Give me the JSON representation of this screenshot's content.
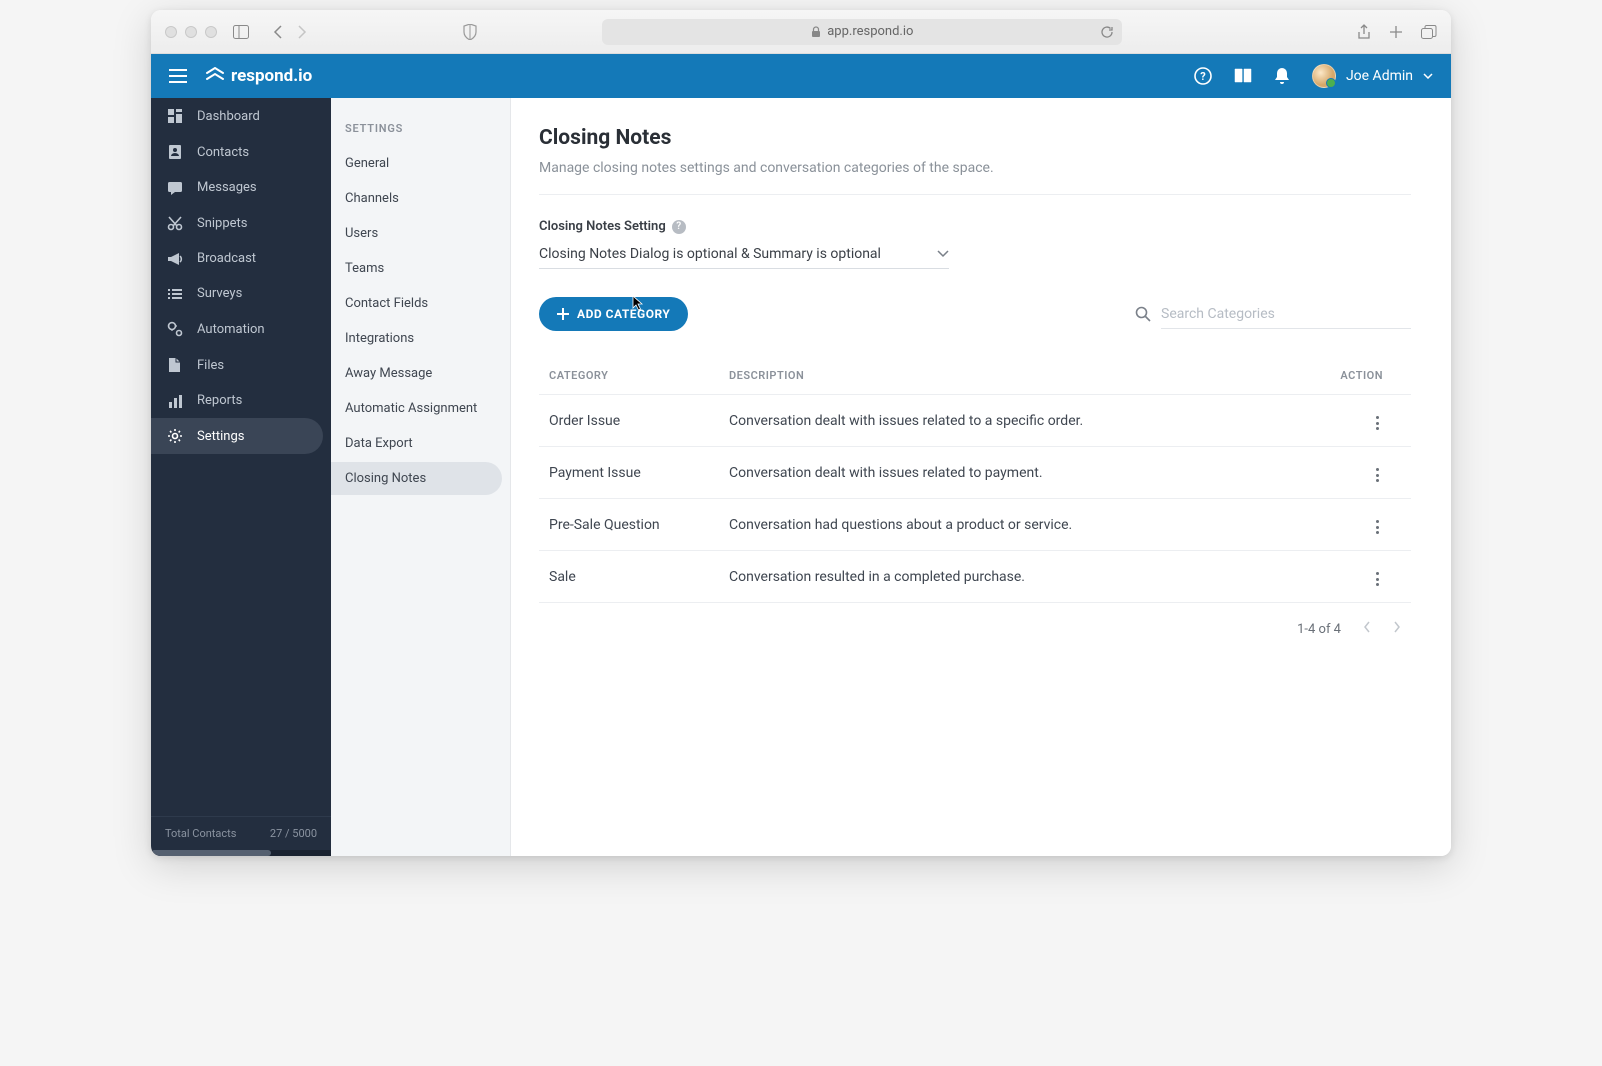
{
  "browser": {
    "url": "app.respond.io"
  },
  "header": {
    "brand": "respond.io",
    "user_name": "Joe Admin"
  },
  "sidebar_primary": {
    "items": [
      {
        "label": "Dashboard",
        "icon": "dashboard"
      },
      {
        "label": "Contacts",
        "icon": "contacts"
      },
      {
        "label": "Messages",
        "icon": "messages"
      },
      {
        "label": "Snippets",
        "icon": "snippets"
      },
      {
        "label": "Broadcast",
        "icon": "broadcast"
      },
      {
        "label": "Surveys",
        "icon": "surveys"
      },
      {
        "label": "Automation",
        "icon": "automation"
      },
      {
        "label": "Files",
        "icon": "files"
      },
      {
        "label": "Reports",
        "icon": "reports"
      },
      {
        "label": "Settings",
        "icon": "settings",
        "active": true
      }
    ],
    "footer_label": "Total Contacts",
    "footer_value": "27 / 5000"
  },
  "sidebar_secondary": {
    "heading": "SETTINGS",
    "items": [
      "General",
      "Channels",
      "Users",
      "Teams",
      "Contact Fields",
      "Integrations",
      "Away Message",
      "Automatic Assignment",
      "Data Export",
      "Closing Notes"
    ],
    "active_index": 9
  },
  "page": {
    "title": "Closing Notes",
    "subtitle": "Manage closing notes settings and conversation categories of the space.",
    "setting_label": "Closing Notes Setting",
    "select_value": "Closing Notes Dialog is optional & Summary is optional",
    "add_button": "ADD CATEGORY",
    "search_placeholder": "Search Categories",
    "columns": {
      "c1": "CATEGORY",
      "c2": "DESCRIPTION",
      "c3": "ACTION"
    },
    "rows": [
      {
        "category": "Order Issue",
        "description": "Conversation dealt with issues related to a specific order."
      },
      {
        "category": "Payment Issue",
        "description": "Conversation dealt with issues related to payment."
      },
      {
        "category": "Pre-Sale Question",
        "description": "Conversation had questions about a product or service."
      },
      {
        "category": "Sale",
        "description": "Conversation resulted in a completed purchase."
      }
    ],
    "pagination": "1-4 of 4"
  }
}
